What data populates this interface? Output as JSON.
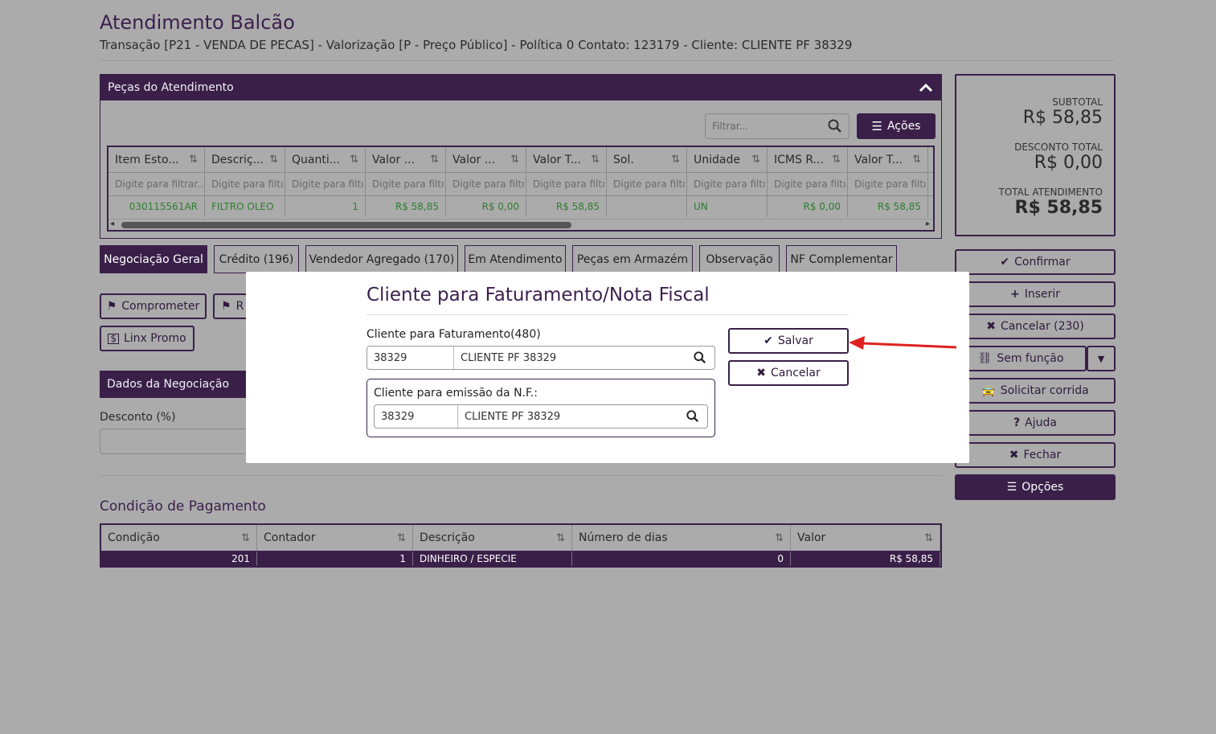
{
  "page": {
    "title": "Atendimento Balcão",
    "subtitle": "Transação [P21 - VENDA DE PECAS] - Valorização [P - Preço Público] - Política 0 Contato: 123179 - Cliente: CLIENTE PF 38329"
  },
  "pecas": {
    "title": "Peças do Atendimento",
    "filter_placeholder": "Filtrar...",
    "actions_label": "Ações",
    "columns": [
      "Item Esto...",
      "Descriç...",
      "Quanti...",
      "Valor ...",
      "Valor ...",
      "Valor T...",
      "Sol.",
      "Unidade",
      "ICMS R...",
      "Valor T..."
    ],
    "filters": [
      "Digite para filtrar...",
      "Digite para filtı",
      "Digite para filtı",
      "Digite para filtı",
      "Digite para filtı",
      "Digite para filtı",
      "Digite para filtı",
      "Digite para filtı",
      "Digite para filtı",
      "Digite para filtı"
    ],
    "row": [
      "030115561AR",
      "FILTRO OLEO",
      "1",
      "R$ 58,85",
      "R$ 0,00",
      "R$ 58,85",
      "",
      "UN",
      "R$ 0,00",
      "R$ 58,85"
    ]
  },
  "tabs": [
    {
      "label": "Negociação Geral",
      "active": true
    },
    {
      "label": "Crédito (196)"
    },
    {
      "label": "Vendedor Agregado (170)"
    },
    {
      "label": "Em Atendimento"
    },
    {
      "label": "Peças em Armazém"
    },
    {
      "label": "Observação"
    },
    {
      "label": "NF Complementar"
    }
  ],
  "left_actions": {
    "comprometer": "Comprometer",
    "second": "R",
    "linx_promo": "Linx Promo"
  },
  "negociacao": {
    "title": "Dados da Negociação",
    "desconto_label": "Desconto (%)"
  },
  "totals": {
    "subtotal_label": "SUBTOTAL",
    "subtotal_value": "R$ 58,85",
    "desconto_label": "DESCONTO TOTAL",
    "desconto_value": "R$ 0,00",
    "total_label": "TOTAL ATENDIMENTO",
    "total_value": "R$ 58,85"
  },
  "side_buttons": {
    "confirmar": "Confirmar",
    "inserir": "Inserir",
    "cancelar": "Cancelar (230)",
    "sem_funcao": "Sem função",
    "solicitar": "Solicitar corrida",
    "ajuda": "Ajuda",
    "fechar": "Fechar",
    "opcoes": "Opções"
  },
  "pagamento": {
    "title": "Condição de Pagamento",
    "columns": [
      "Condição",
      "Contador",
      "Descrição",
      "Número de dias",
      "Valor"
    ],
    "row": [
      "201",
      "1",
      "DINHEIRO / ESPECIE",
      "0",
      "R$ 58,85"
    ]
  },
  "modal": {
    "title": "Cliente para Faturamento/Nota Fiscal",
    "faturamento_label": "Cliente para Faturamento(480)",
    "faturamento_code": "38329",
    "faturamento_name": "CLIENTE PF 38329",
    "emissao_label": "Cliente para emissão da N.F.:",
    "emissao_code": "38329",
    "emissao_name": "CLIENTE PF 38329",
    "salvar": "Salvar",
    "cancelar": "Cancelar"
  },
  "colors": {
    "brand": "#3a2049",
    "arrow": "#e02020"
  }
}
